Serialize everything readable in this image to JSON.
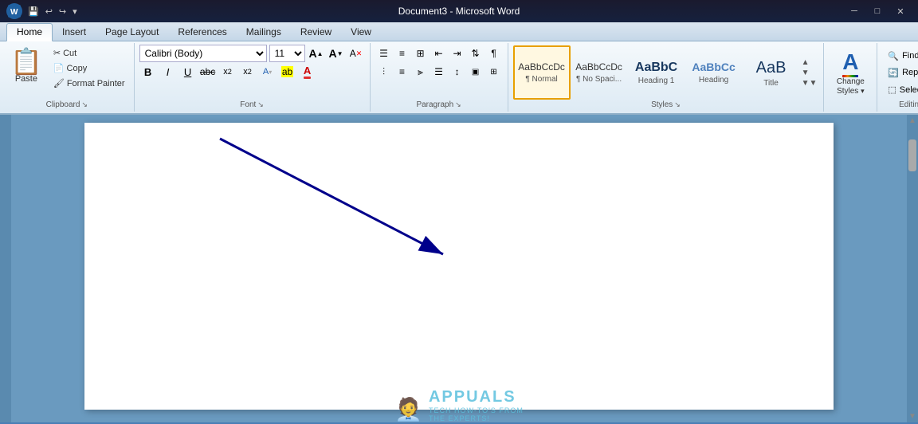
{
  "titlebar": {
    "title": "Document3 - Microsoft Word",
    "min_label": "─",
    "max_label": "□",
    "close_label": "✕"
  },
  "tabs": [
    {
      "label": "Home",
      "active": true
    },
    {
      "label": "Insert",
      "active": false
    },
    {
      "label": "Page Layout",
      "active": false
    },
    {
      "label": "References",
      "active": false
    },
    {
      "label": "Mailings",
      "active": false
    },
    {
      "label": "Review",
      "active": false
    },
    {
      "label": "View",
      "active": false
    }
  ],
  "clipboard": {
    "paste_label": "Paste",
    "cut_label": "Cut",
    "copy_label": "Copy",
    "format_painter_label": "Format Painter",
    "group_label": "Clipboard"
  },
  "font": {
    "family": "Calibri (Body)",
    "size": "11",
    "group_label": "Font",
    "bold": "B",
    "italic": "I",
    "underline": "U",
    "strikethrough": "abc",
    "subscript": "x₂",
    "superscript": "x²",
    "grow": "A",
    "shrink": "A",
    "clear": "A",
    "color_a": "A",
    "highlight": "ab"
  },
  "paragraph": {
    "group_label": "Paragraph"
  },
  "styles": {
    "group_label": "Styles",
    "items": [
      {
        "label": "¶ Normal",
        "preview": "AaBbCcDc",
        "type": "normal",
        "active": true
      },
      {
        "label": "¶ No Spaci...",
        "preview": "AaBbCcDc",
        "type": "nospace",
        "active": false
      },
      {
        "label": "Heading 1",
        "preview": "AaBbC",
        "type": "h1",
        "active": false
      },
      {
        "label": "Heading",
        "preview": "AaBbCc",
        "type": "h2",
        "active": false
      },
      {
        "label": "Title",
        "preview": "AaB",
        "type": "title",
        "active": false
      }
    ]
  },
  "change_styles": {
    "label": "Change\nStyles",
    "icon": "A"
  },
  "editing": {
    "group_label": "Editing",
    "find_label": "Find",
    "replace_label": "Replace",
    "select_label": "Select ▾"
  }
}
